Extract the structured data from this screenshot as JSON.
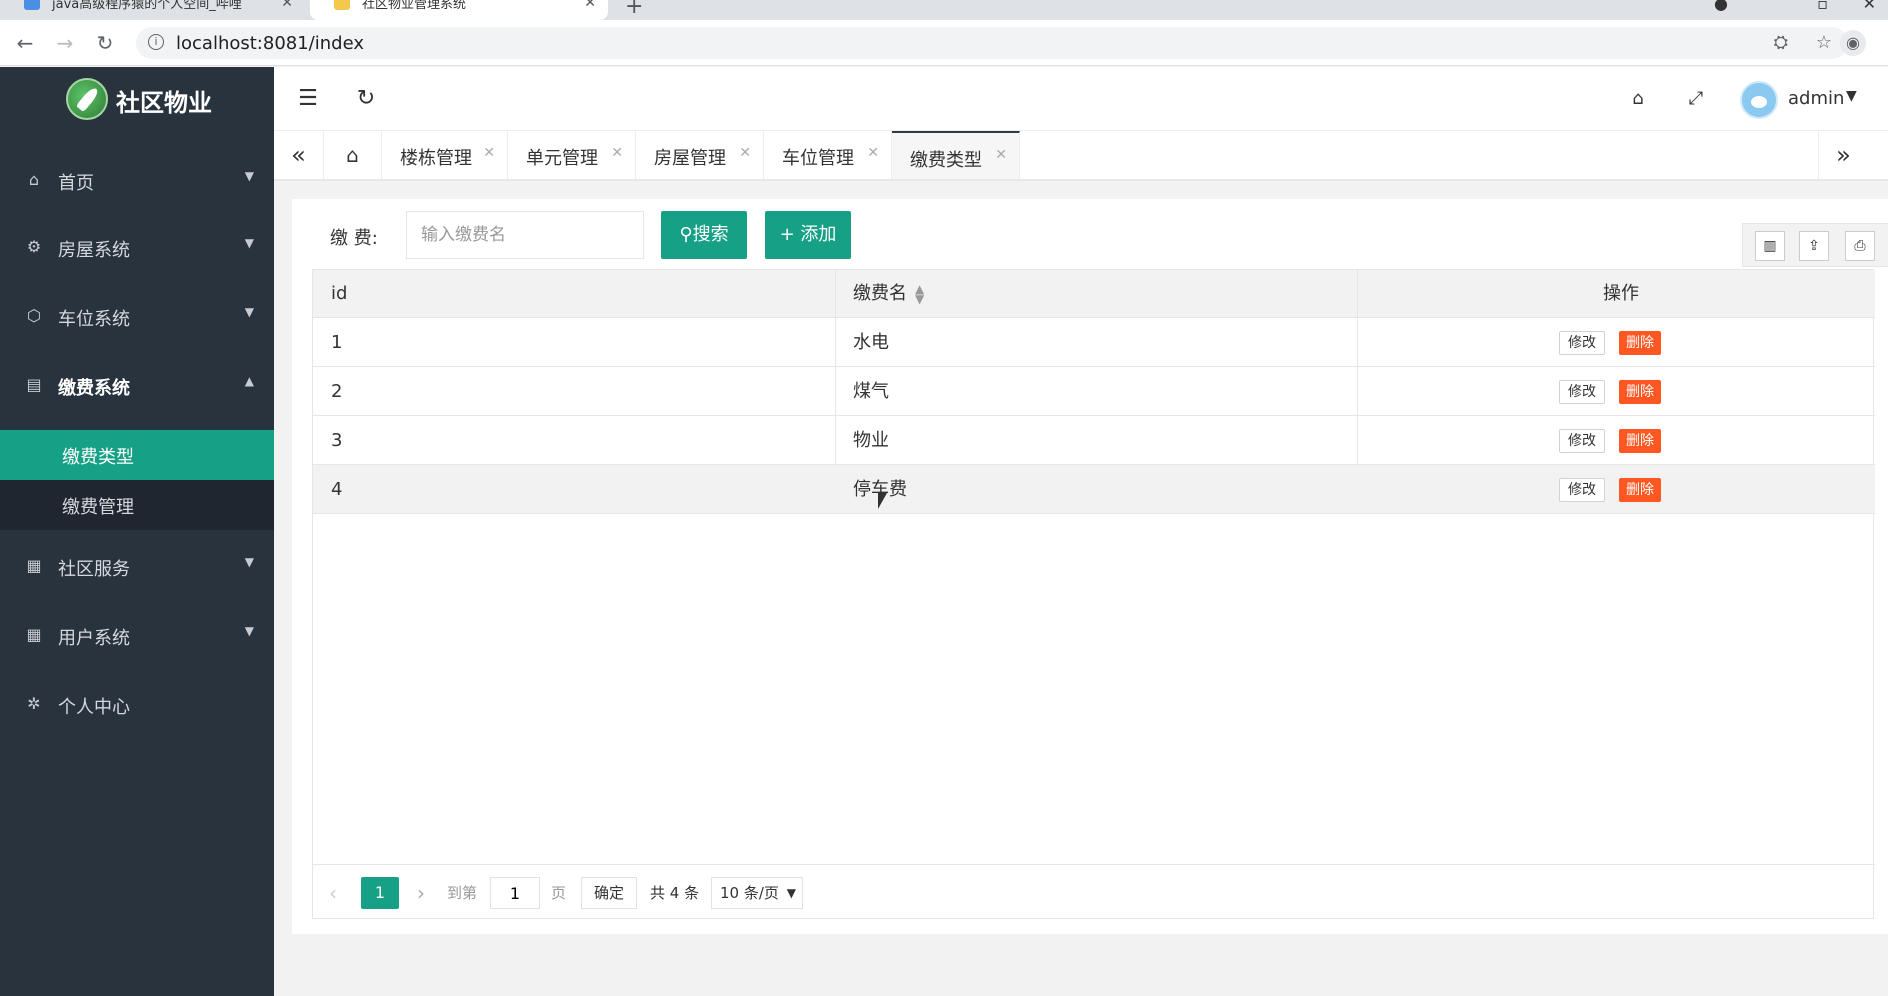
{
  "browser": {
    "tabs": [
      {
        "title": "java高级程序猿的个人空间_哔哩"
      },
      {
        "title": "社区物业管理系统"
      }
    ],
    "url": "localhost:8081/index"
  },
  "sidebar": {
    "logo_text": "社区物业",
    "items": [
      {
        "label": "首页"
      },
      {
        "label": "房屋系统"
      },
      {
        "label": "车位系统"
      },
      {
        "label": "缴费系统"
      },
      {
        "label": "社区服务"
      },
      {
        "label": "用户系统"
      },
      {
        "label": "个人中心"
      }
    ],
    "submenu": [
      {
        "label": "缴费类型"
      },
      {
        "label": "缴费管理"
      }
    ]
  },
  "header": {
    "username": "admin"
  },
  "tabs": [
    {
      "label": "楼栋管理"
    },
    {
      "label": "单元管理"
    },
    {
      "label": "房屋管理"
    },
    {
      "label": "车位管理"
    },
    {
      "label": "缴费类型"
    }
  ],
  "search": {
    "label": "缴 费:",
    "placeholder": "输入缴费名",
    "search_label": "搜索",
    "add_label": "添加"
  },
  "table": {
    "headers": [
      "id",
      "缴费名",
      "操作"
    ],
    "rows": [
      {
        "id": "1",
        "name": "水电"
      },
      {
        "id": "2",
        "name": "煤气"
      },
      {
        "id": "3",
        "name": "物业"
      },
      {
        "id": "4",
        "name": "停车费"
      }
    ],
    "edit_label": "修改",
    "delete_label": "删除"
  },
  "pager": {
    "current": "1",
    "goto_label": "到第",
    "goto_value": "1",
    "page_label": "页",
    "confirm_label": "确定",
    "total_label": "共 4 条",
    "page_size": "10 条/页"
  }
}
